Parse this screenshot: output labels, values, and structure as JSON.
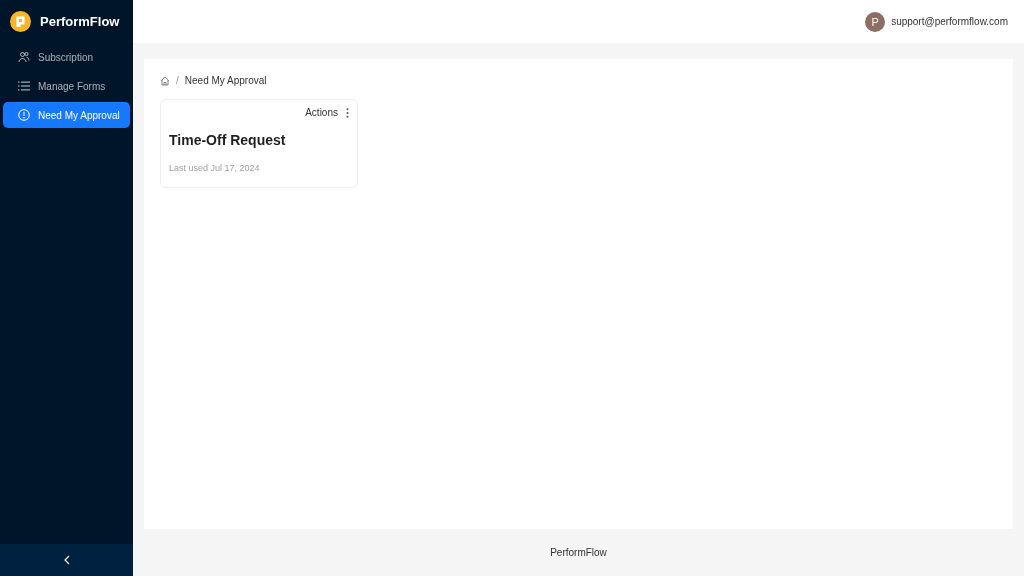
{
  "sidebar": {
    "brand": "PerformFlow",
    "items": [
      {
        "label": "Subscription",
        "kind": "people",
        "selected": false
      },
      {
        "label": "Manage Forms",
        "kind": "list",
        "selected": false
      },
      {
        "label": "Need My Approval",
        "kind": "info",
        "selected": true
      }
    ]
  },
  "header": {
    "avatar_letter": "P",
    "email": "support@performflow.com"
  },
  "breadcrumb": {
    "separator": "/",
    "items": [
      "Need My Approval"
    ]
  },
  "cards": [
    {
      "actions": "Actions",
      "title": "Time-Off Request",
      "meta": "Last used Jul 17, 2024"
    }
  ],
  "footer": "PerformFlow"
}
